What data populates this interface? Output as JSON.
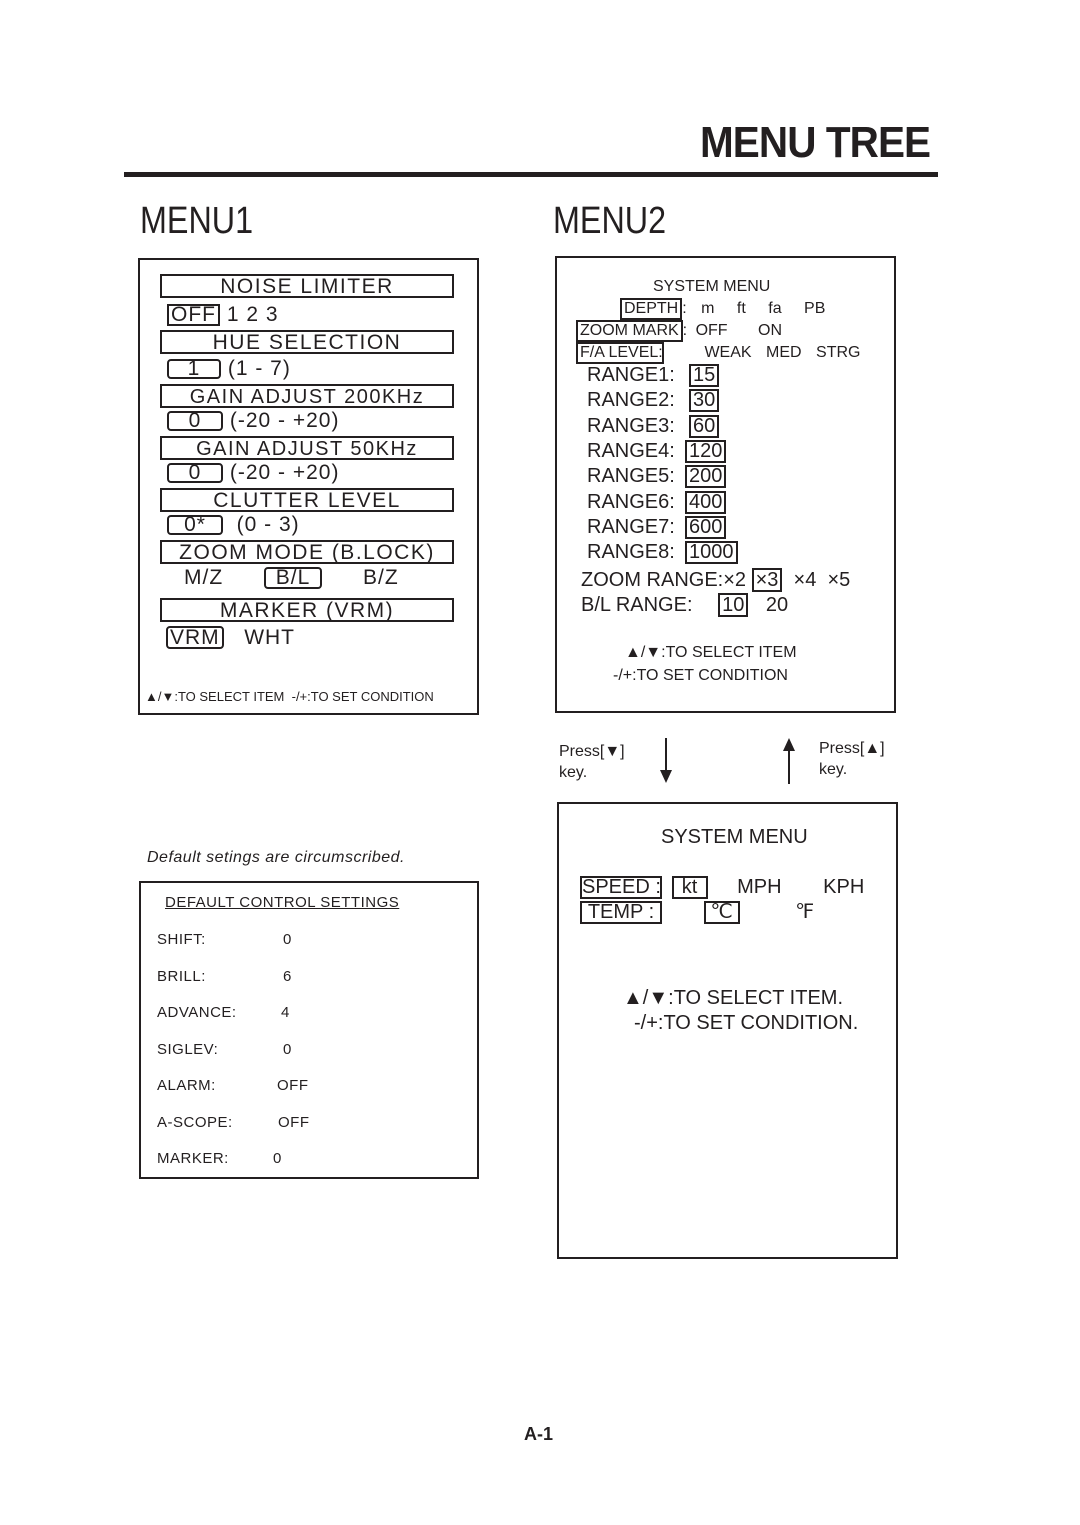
{
  "page": {
    "title": "MENU TREE",
    "footer": "A-1"
  },
  "menu1": {
    "heading": "MENU1",
    "noise_limiter": {
      "label": "NOISE LIMITER",
      "options": [
        "OFF",
        "1",
        "2",
        "3"
      ],
      "selected": "OFF"
    },
    "hue_selection": {
      "label": "HUE SELECTION",
      "value": "1",
      "range": "(1 - 7)"
    },
    "gain_200": {
      "label": "GAIN ADJUST 200KHz",
      "value": "0",
      "range": "(-20 - +20)"
    },
    "gain_50": {
      "label": "GAIN ADJUST 50KHz",
      "value": "0",
      "range": "(-20 - +20)"
    },
    "clutter": {
      "label": "CLUTTER LEVEL",
      "value": "0*",
      "range": "(0 - 3)"
    },
    "zoom_mode": {
      "label": "ZOOM MODE (B.LOCK)",
      "options": [
        "M/Z",
        "B/L",
        "B/Z"
      ],
      "selected": "B/L"
    },
    "marker": {
      "label": "MARKER (VRM)",
      "options": [
        "VRM",
        "WHT"
      ],
      "selected": "VRM"
    },
    "hint": "▲/▼:TO SELECT ITEM  -/+:TO SET CONDITION"
  },
  "menu2": {
    "heading": "MENU2",
    "system_menu_1": {
      "title": "SYSTEM MENU",
      "depth": {
        "label": "DEPTH",
        "options": [
          "m",
          "ft",
          "fa",
          "PB"
        ]
      },
      "zoom_mark": {
        "label": "ZOOM MARK",
        "options": [
          "OFF",
          "ON"
        ]
      },
      "fa_level": {
        "label": "F/A LEVEL:",
        "options": [
          "WEAK",
          "MED",
          "STRG"
        ]
      },
      "ranges": [
        {
          "label": "RANGE1:",
          "value": "15"
        },
        {
          "label": "RANGE2:",
          "value": "30"
        },
        {
          "label": "RANGE3:",
          "value": "60"
        },
        {
          "label": "RANGE4:",
          "value": "120"
        },
        {
          "label": "RANGE5:",
          "value": "200"
        },
        {
          "label": "RANGE6:",
          "value": "400"
        },
        {
          "label": "RANGE7:",
          "value": "600"
        },
        {
          "label": "RANGE8:",
          "value": "1000"
        }
      ],
      "zoom_range": {
        "label": "ZOOM RANGE:",
        "options": [
          "×2",
          "×3",
          "×4",
          "×5"
        ],
        "selected": "×3"
      },
      "bl_range": {
        "label": "B/L RANGE:",
        "options": [
          "10",
          "20"
        ],
        "selected": "10"
      },
      "hint1": "▲/▼:TO SELECT ITEM",
      "hint2": "-/+:TO SET CONDITION"
    },
    "nav": {
      "down": "Press[▼]",
      "down2": "key.",
      "up": "Press[▲]",
      "up2": "key."
    },
    "system_menu_2": {
      "title": "SYSTEM MENU",
      "speed": {
        "label": "SPEED :",
        "options": [
          "kt",
          "MPH",
          "KPH"
        ],
        "selected": "kt"
      },
      "temp": {
        "label": "TEMP :",
        "options": [
          "℃",
          "℉"
        ],
        "selected": "℃"
      },
      "hint1": "▲/▼:TO SELECT ITEM.",
      "hint2": "-/+:TO SET CONDITION."
    }
  },
  "defaults": {
    "note": "Default setings are circumscribed.",
    "title": "DEFAULT CONTROL SETTINGS",
    "rows": [
      {
        "label": "SHIFT:",
        "value": "0"
      },
      {
        "label": "BRILL:",
        "value": "6"
      },
      {
        "label": "ADVANCE:",
        "value": "4"
      },
      {
        "label": "SIGLEV:",
        "value": "0"
      },
      {
        "label": "ALARM:",
        "value": "OFF"
      },
      {
        "label": "A-SCOPE:",
        "value": "OFF"
      },
      {
        "label": "MARKER:",
        "value": "0"
      }
    ]
  }
}
